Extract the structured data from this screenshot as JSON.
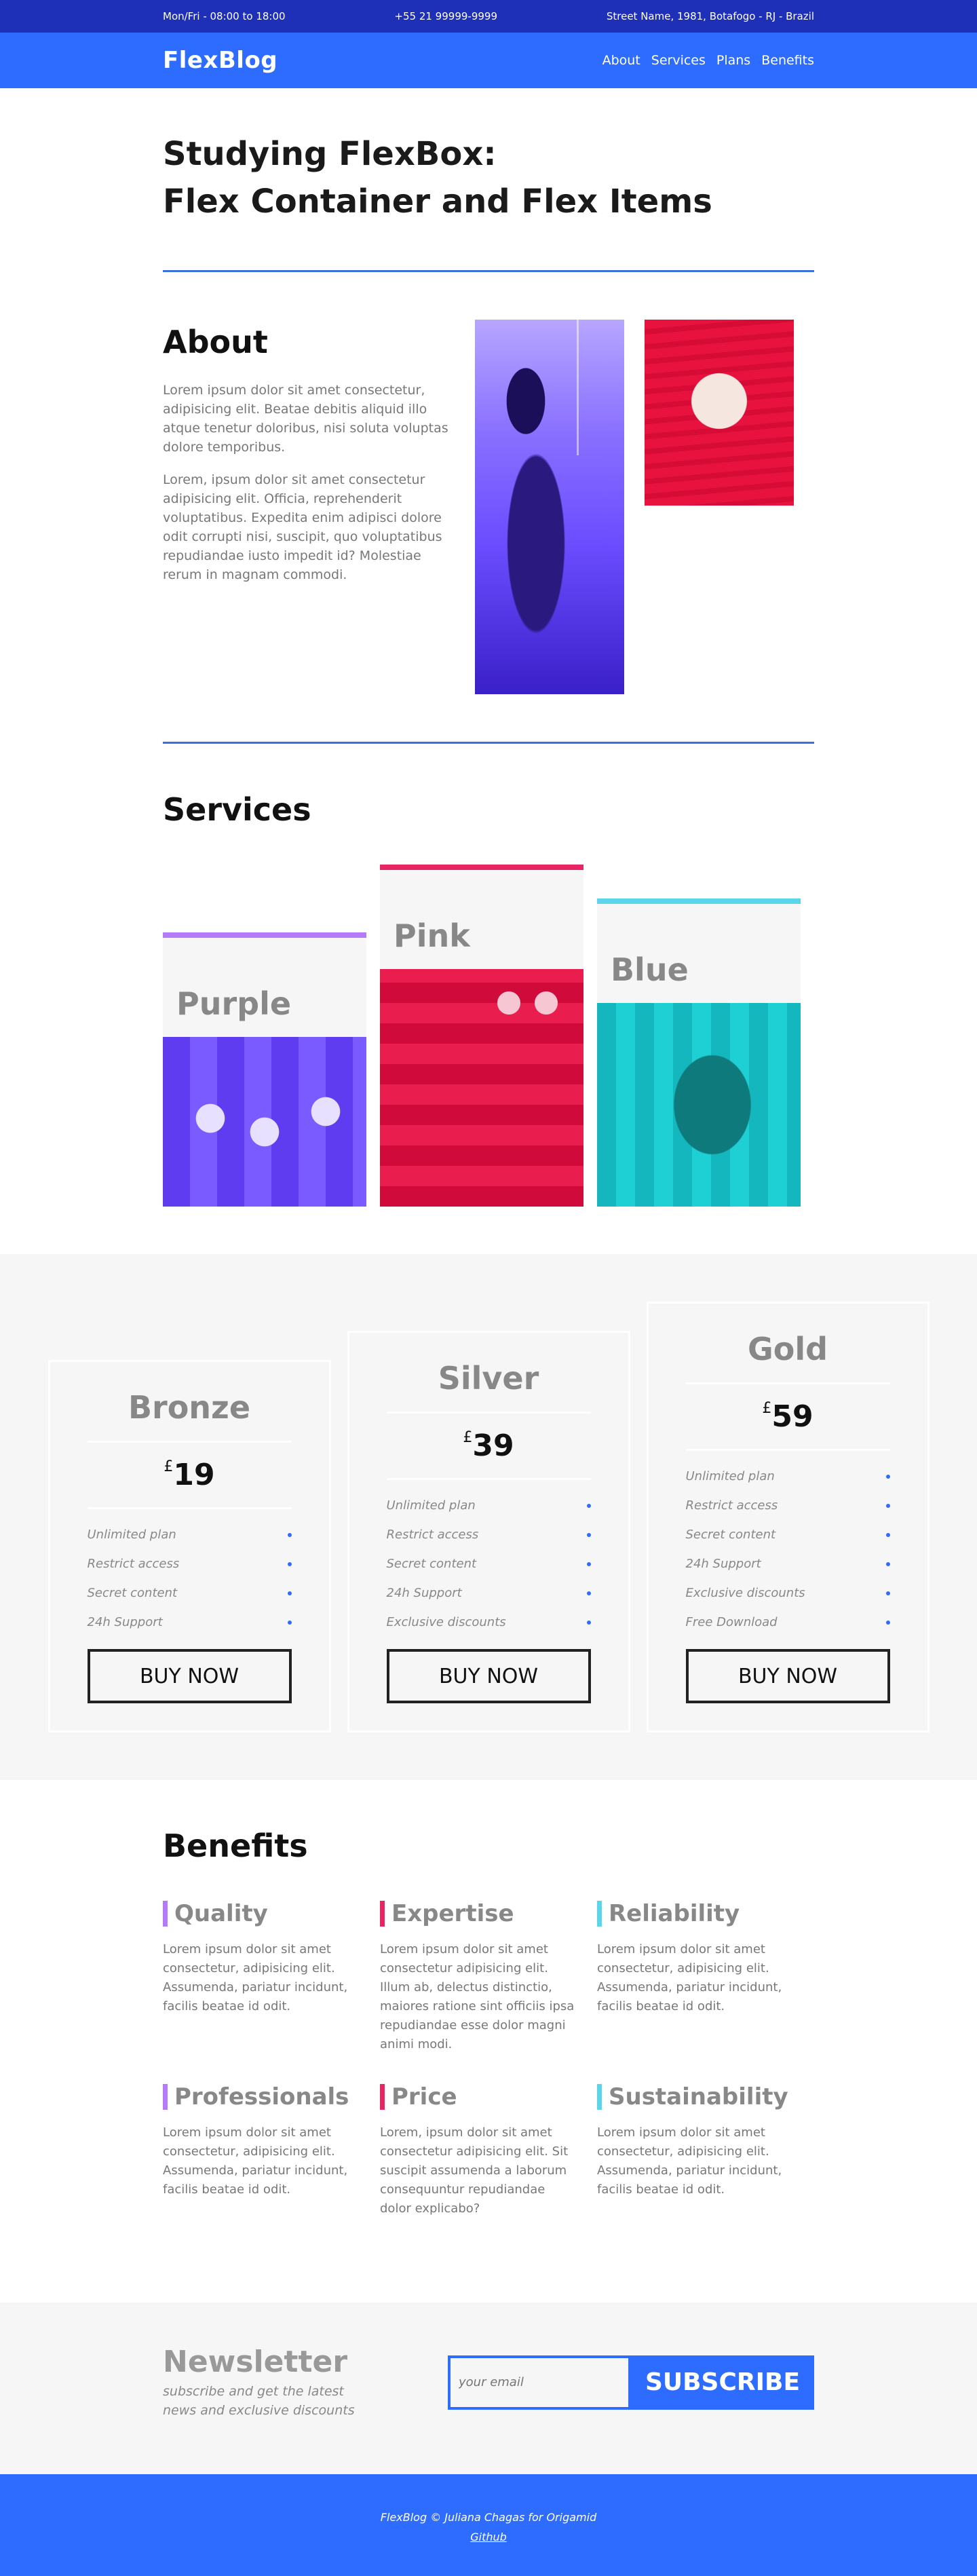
{
  "topbar": {
    "hours": "Mon/Fri - 08:00 to 18:00",
    "phone": "+55 21 99999-9999",
    "address": "Street Name, 1981, Botafogo - RJ - Brazil"
  },
  "header": {
    "logo": "FlexBlog",
    "nav": [
      "About",
      "Services",
      "Plans",
      "Benefits"
    ]
  },
  "hero": {
    "line1": "Studying FlexBox:",
    "line2": "Flex Container and Flex Items"
  },
  "about": {
    "title": "About",
    "p1": "Lorem ipsum dolor sit amet consectetur, adipisicing elit. Beatae debitis aliquid illo atque tenetur doloribus, nisi soluta voluptas dolore temporibus.",
    "p2": "Lorem, ipsum dolor sit amet consectetur adipisicing elit. Officia, reprehenderit voluptatibus. Expedita enim adipisci dolore odit corrupti nisi, suscipit, quo voluptatibus repudiandae iusto impedit id? Molestiae rerum in magnam commodi."
  },
  "services": {
    "title": "Services",
    "items": [
      "Purple",
      "Pink",
      "Blue"
    ]
  },
  "plans": [
    {
      "name": "Bronze",
      "currency": "£",
      "price": "19",
      "features": [
        "Unlimited plan",
        "Restrict access",
        "Secret content",
        "24h Support"
      ],
      "button": "BUY NOW"
    },
    {
      "name": "Silver",
      "currency": "£",
      "price": "39",
      "features": [
        "Unlimited plan",
        "Restrict access",
        "Secret content",
        "24h Support",
        "Exclusive discounts"
      ],
      "button": "BUY NOW"
    },
    {
      "name": "Gold",
      "currency": "£",
      "price": "59",
      "features": [
        "Unlimited plan",
        "Restrict access",
        "Secret content",
        "24h Support",
        "Exclusive discounts",
        "Free Download"
      ],
      "button": "BUY NOW"
    }
  ],
  "benefits": {
    "title": "Benefits",
    "items": [
      {
        "title": "Quality",
        "text": "Lorem ipsum dolor sit amet consectetur, adipisicing elit. Assumenda, pariatur incidunt, facilis beatae id odit."
      },
      {
        "title": "Expertise",
        "text": "Lorem ipsum dolor sit amet consectetur adipisicing elit. Illum ab, delectus distinctio, maiores ratione sint officiis ipsa repudiandae esse dolor magni animi modi."
      },
      {
        "title": "Reliability",
        "text": "Lorem ipsum dolor sit amet consectetur, adipisicing elit. Assumenda, pariatur incidunt, facilis beatae id odit."
      },
      {
        "title": "Professionals",
        "text": "Lorem ipsum dolor sit amet consectetur, adipisicing elit. Assumenda, pariatur incidunt, facilis beatae id odit."
      },
      {
        "title": "Price",
        "text": "Lorem, ipsum dolor sit amet consectetur adipisicing elit. Sit suscipit assumenda a laborum consequuntur repudiandae dolor explicabo?"
      },
      {
        "title": "Sustainability",
        "text": "Lorem ipsum dolor sit amet consectetur, adipisicing elit. Assumenda, pariatur incidunt, facilis beatae id odit."
      }
    ]
  },
  "newsletter": {
    "title": "Newsletter",
    "subtitle": "subscribe and get the latest news and exclusive discounts",
    "placeholder": "your email",
    "button": "SUBSCRIBE"
  },
  "footer": {
    "credit": "FlexBlog © Juliana Chagas for Origamid",
    "link": "Github"
  },
  "colors": {
    "primary": "#2d6cff",
    "topbar": "#1e2fb8",
    "purple": "#b47af7",
    "pink": "#e82563",
    "blue": "#5ad5ea"
  }
}
